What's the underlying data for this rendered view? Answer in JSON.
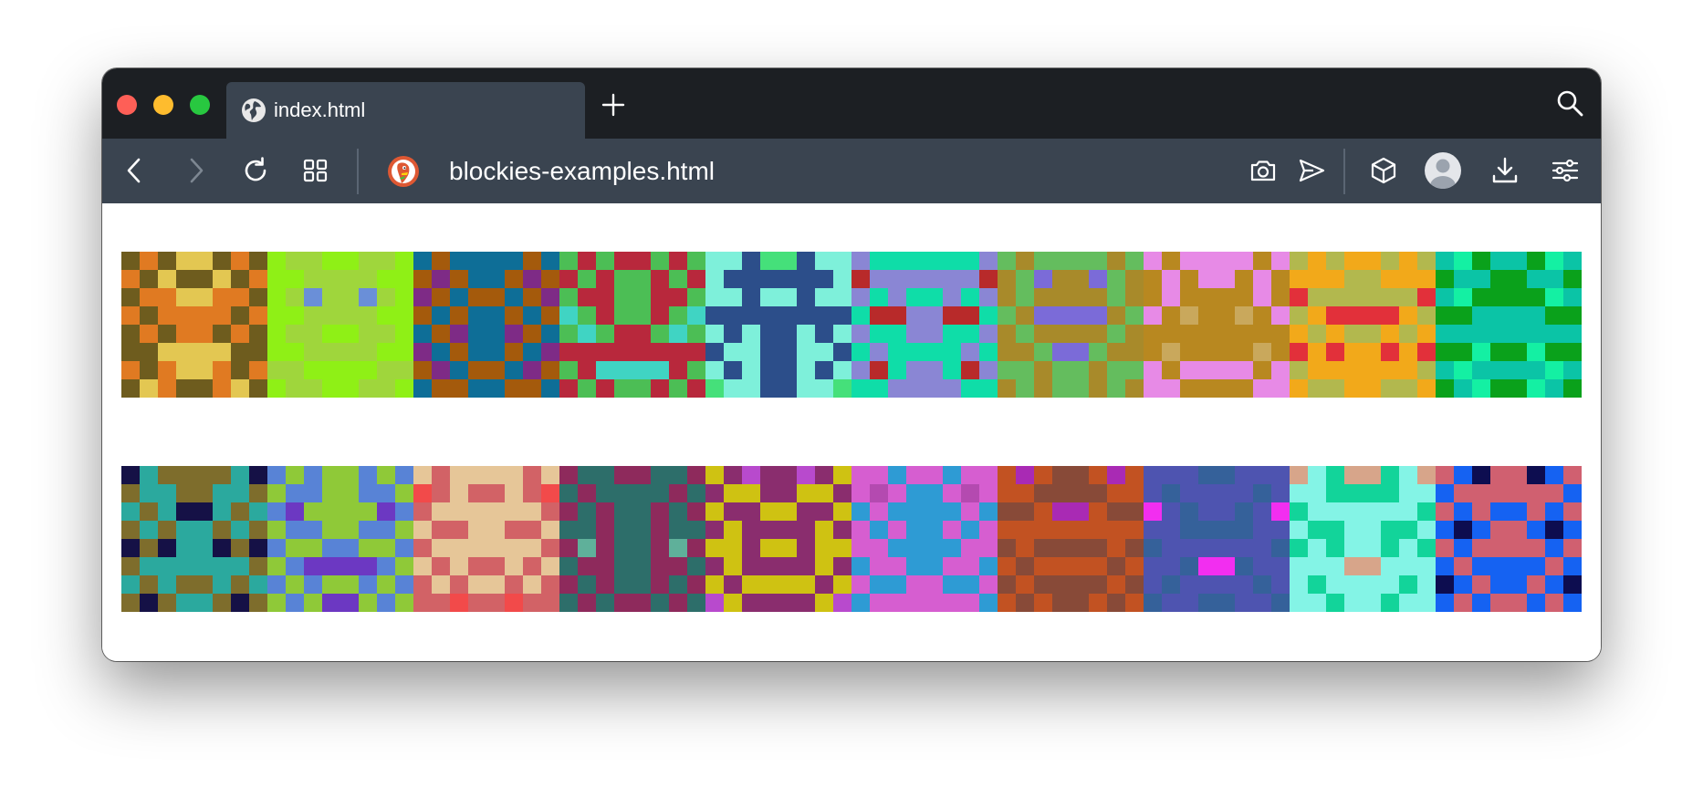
{
  "tab": {
    "title": "index.html",
    "icon": "globe-icon"
  },
  "address_bar": {
    "url": "blockies-examples.html",
    "site_icon": "duckduckgo-icon"
  },
  "toolbar": {
    "back_icon": "back-arrow-icon",
    "forward_icon": "forward-arrow-icon",
    "reload_icon": "reload-icon",
    "tabs_icon": "tab-grid-icon",
    "screenshot_icon": "camera-icon",
    "share_icon": "send-icon",
    "extensions_icon": "cube-icon",
    "profile_icon": "avatar-icon",
    "downloads_icon": "download-icon",
    "settings_icon": "sliders-icon"
  },
  "colors": {
    "titlebar": "#1c1f23",
    "toolbar": "#3a4450",
    "tab_active": "#3a4450",
    "close": "#fe5f57",
    "minimize": "#febc2e",
    "maximize": "#28c840"
  },
  "blockies": [
    {
      "colors": [
        "#6e5c1e",
        "#e07a22",
        "#e3c752"
      ],
      "pattern": [
        0,
        1,
        0,
        2,
        2,
        0,
        1,
        0,
        1,
        0,
        2,
        0,
        0,
        2,
        0,
        1,
        0,
        1,
        1,
        2,
        2,
        1,
        1,
        0,
        1,
        0,
        1,
        1,
        1,
        1,
        0,
        1,
        0,
        1,
        0,
        1,
        1,
        0,
        1,
        0,
        0,
        0,
        2,
        2,
        2,
        2,
        0,
        0,
        1,
        0,
        1,
        2,
        2,
        1,
        0,
        1,
        0,
        2,
        1,
        0,
        0,
        1,
        2,
        0
      ]
    },
    {
      "colors": [
        "#8ff016",
        "#9fd63c",
        "#6a8fd8"
      ],
      "pattern": [
        0,
        1,
        1,
        0,
        0,
        1,
        1,
        0,
        0,
        0,
        1,
        1,
        1,
        1,
        0,
        0,
        0,
        1,
        2,
        1,
        1,
        2,
        1,
        0,
        0,
        0,
        1,
        1,
        1,
        1,
        0,
        0,
        0,
        1,
        1,
        0,
        0,
        1,
        1,
        0,
        0,
        0,
        1,
        1,
        1,
        1,
        0,
        0,
        1,
        1,
        0,
        0,
        0,
        0,
        1,
        1,
        0,
        1,
        1,
        0,
        0,
        1,
        1,
        0
      ]
    },
    {
      "colors": [
        "#a45a0c",
        "#0e6e97",
        "#7e2b86"
      ],
      "pattern": [
        1,
        0,
        1,
        1,
        1,
        1,
        0,
        1,
        0,
        2,
        0,
        1,
        1,
        0,
        2,
        0,
        2,
        0,
        1,
        0,
        0,
        1,
        0,
        2,
        0,
        1,
        0,
        1,
        1,
        0,
        1,
        0,
        1,
        0,
        2,
        1,
        1,
        2,
        0,
        1,
        2,
        1,
        0,
        1,
        1,
        0,
        1,
        2,
        0,
        2,
        1,
        0,
        0,
        1,
        2,
        0,
        1,
        0,
        0,
        1,
        1,
        0,
        0,
        1
      ]
    },
    {
      "colors": [
        "#4cbe55",
        "#b8283c",
        "#40d4c3"
      ],
      "pattern": [
        0,
        1,
        0,
        1,
        1,
        0,
        1,
        0,
        1,
        0,
        1,
        0,
        0,
        1,
        0,
        1,
        0,
        1,
        1,
        0,
        0,
        1,
        1,
        0,
        2,
        0,
        1,
        0,
        0,
        1,
        0,
        2,
        0,
        2,
        0,
        1,
        1,
        0,
        2,
        0,
        1,
        1,
        1,
        1,
        1,
        1,
        1,
        1,
        0,
        1,
        2,
        2,
        2,
        2,
        1,
        0,
        1,
        0,
        1,
        0,
        0,
        1,
        0,
        1
      ]
    },
    {
      "colors": [
        "#7ef0da",
        "#2c4e8a",
        "#45e07a"
      ],
      "pattern": [
        0,
        0,
        1,
        2,
        2,
        1,
        0,
        0,
        0,
        1,
        1,
        1,
        1,
        1,
        1,
        0,
        0,
        0,
        1,
        0,
        0,
        1,
        0,
        0,
        1,
        1,
        1,
        1,
        1,
        1,
        1,
        1,
        0,
        1,
        0,
        1,
        1,
        0,
        1,
        0,
        1,
        0,
        0,
        1,
        1,
        0,
        0,
        1,
        0,
        1,
        0,
        1,
        1,
        0,
        1,
        0,
        2,
        0,
        0,
        1,
        1,
        0,
        0,
        2
      ]
    },
    {
      "colors": [
        "#8a86d4",
        "#0fdda8",
        "#b82a2a"
      ],
      "pattern": [
        0,
        1,
        1,
        1,
        1,
        1,
        1,
        0,
        2,
        0,
        0,
        0,
        0,
        0,
        0,
        2,
        0,
        1,
        0,
        1,
        1,
        0,
        1,
        0,
        1,
        2,
        2,
        0,
        0,
        2,
        2,
        1,
        0,
        1,
        1,
        0,
        0,
        1,
        1,
        0,
        1,
        0,
        1,
        1,
        1,
        1,
        0,
        1,
        0,
        2,
        1,
        0,
        0,
        1,
        2,
        0,
        1,
        1,
        0,
        0,
        0,
        0,
        1,
        1
      ]
    },
    {
      "colors": [
        "#a88a2a",
        "#64bd5e",
        "#7b6bd8"
      ],
      "pattern": [
        1,
        0,
        1,
        1,
        1,
        1,
        0,
        1,
        0,
        1,
        2,
        0,
        0,
        2,
        1,
        0,
        0,
        1,
        0,
        0,
        0,
        0,
        1,
        0,
        1,
        0,
        2,
        2,
        2,
        2,
        0,
        1,
        0,
        1,
        0,
        0,
        0,
        0,
        1,
        0,
        0,
        0,
        1,
        2,
        2,
        1,
        0,
        0,
        1,
        1,
        0,
        1,
        1,
        0,
        1,
        1,
        0,
        1,
        0,
        1,
        1,
        0,
        1,
        0
      ]
    },
    {
      "colors": [
        "#b88820",
        "#e78ae6",
        "#c9a85c"
      ],
      "pattern": [
        1,
        0,
        1,
        1,
        1,
        1,
        0,
        1,
        0,
        1,
        0,
        1,
        1,
        0,
        1,
        0,
        0,
        1,
        0,
        0,
        0,
        0,
        1,
        0,
        1,
        0,
        2,
        0,
        0,
        2,
        0,
        1,
        0,
        0,
        0,
        0,
        0,
        0,
        0,
        0,
        0,
        2,
        0,
        0,
        0,
        0,
        2,
        0,
        1,
        0,
        1,
        1,
        1,
        1,
        0,
        1,
        1,
        1,
        0,
        0,
        0,
        0,
        1,
        1
      ]
    },
    {
      "colors": [
        "#b2b84e",
        "#f2a91a",
        "#e2303a"
      ],
      "pattern": [
        0,
        1,
        0,
        1,
        1,
        0,
        1,
        0,
        1,
        1,
        1,
        0,
        0,
        1,
        1,
        1,
        2,
        0,
        0,
        0,
        0,
        0,
        0,
        2,
        0,
        1,
        2,
        2,
        2,
        2,
        1,
        0,
        1,
        0,
        1,
        0,
        0,
        1,
        0,
        1,
        2,
        1,
        2,
        1,
        1,
        2,
        1,
        2,
        0,
        1,
        1,
        1,
        1,
        1,
        1,
        0,
        1,
        0,
        0,
        1,
        1,
        0,
        0,
        1
      ]
    },
    {
      "colors": [
        "#0bc4a6",
        "#0aa11b",
        "#14f0a3"
      ],
      "pattern": [
        0,
        2,
        1,
        0,
        0,
        1,
        2,
        0,
        1,
        0,
        0,
        1,
        1,
        0,
        0,
        1,
        0,
        2,
        1,
        1,
        1,
        1,
        2,
        0,
        1,
        1,
        0,
        0,
        0,
        0,
        1,
        1,
        0,
        0,
        0,
        0,
        0,
        0,
        0,
        0,
        1,
        1,
        2,
        1,
        1,
        2,
        1,
        1,
        0,
        2,
        0,
        0,
        0,
        0,
        2,
        0,
        1,
        0,
        2,
        1,
        1,
        2,
        0,
        1
      ]
    },
    {
      "colors": [
        "#7e6d2c",
        "#2ba99e",
        "#151146"
      ],
      "pattern": [
        2,
        1,
        0,
        0,
        0,
        0,
        1,
        2,
        0,
        1,
        1,
        0,
        0,
        1,
        1,
        0,
        1,
        0,
        1,
        2,
        2,
        1,
        0,
        1,
        0,
        1,
        0,
        1,
        1,
        0,
        1,
        0,
        2,
        0,
        2,
        1,
        1,
        2,
        0,
        2,
        0,
        1,
        1,
        1,
        1,
        1,
        1,
        0,
        1,
        0,
        1,
        0,
        0,
        1,
        0,
        1,
        0,
        2,
        0,
        1,
        1,
        0,
        2,
        0
      ]
    },
    {
      "colors": [
        "#5883d6",
        "#8fc938",
        "#6c38c2"
      ],
      "pattern": [
        0,
        1,
        0,
        1,
        1,
        0,
        1,
        0,
        1,
        0,
        0,
        1,
        1,
        0,
        0,
        1,
        0,
        2,
        1,
        1,
        1,
        1,
        2,
        0,
        1,
        0,
        0,
        1,
        1,
        0,
        0,
        1,
        0,
        1,
        1,
        0,
        0,
        1,
        1,
        0,
        1,
        0,
        2,
        2,
        2,
        2,
        0,
        1,
        0,
        1,
        0,
        1,
        1,
        0,
        1,
        0,
        1,
        0,
        1,
        2,
        2,
        1,
        0,
        1
      ]
    },
    {
      "colors": [
        "#d26266",
        "#e6c698",
        "#f24a4a"
      ],
      "pattern": [
        1,
        0,
        1,
        1,
        1,
        1,
        0,
        1,
        2,
        0,
        1,
        0,
        0,
        1,
        0,
        2,
        0,
        1,
        1,
        1,
        1,
        1,
        1,
        0,
        1,
        0,
        0,
        1,
        1,
        0,
        0,
        1,
        0,
        1,
        1,
        1,
        1,
        1,
        1,
        0,
        1,
        0,
        1,
        0,
        0,
        1,
        0,
        1,
        0,
        1,
        0,
        1,
        1,
        0,
        1,
        0,
        0,
        0,
        2,
        0,
        0,
        2,
        0,
        0
      ]
    },
    {
      "colors": [
        "#8e2a5c",
        "#2d6e6a",
        "#5fb09a"
      ],
      "pattern": [
        0,
        1,
        1,
        0,
        0,
        1,
        1,
        0,
        1,
        0,
        1,
        1,
        1,
        1,
        0,
        1,
        0,
        1,
        0,
        1,
        1,
        0,
        1,
        0,
        1,
        1,
        0,
        1,
        1,
        0,
        1,
        1,
        0,
        2,
        0,
        1,
        1,
        0,
        2,
        0,
        1,
        0,
        0,
        1,
        1,
        0,
        0,
        1,
        0,
        1,
        0,
        1,
        1,
        0,
        1,
        0,
        1,
        0,
        1,
        0,
        0,
        1,
        0,
        1
      ]
    },
    {
      "colors": [
        "#cfc212",
        "#8a2d6e",
        "#b84acd"
      ],
      "pattern": [
        0,
        1,
        2,
        1,
        1,
        2,
        1,
        0,
        1,
        0,
        0,
        1,
        1,
        0,
        0,
        1,
        0,
        1,
        1,
        0,
        0,
        1,
        1,
        0,
        1,
        0,
        1,
        1,
        1,
        1,
        0,
        1,
        0,
        0,
        1,
        0,
        0,
        1,
        0,
        0,
        1,
        0,
        1,
        1,
        1,
        1,
        0,
        1,
        0,
        1,
        0,
        0,
        0,
        0,
        1,
        0,
        2,
        0,
        1,
        1,
        1,
        1,
        0,
        2
      ]
    },
    {
      "colors": [
        "#d65ed0",
        "#2e9bd4",
        "#b44ab0"
      ],
      "pattern": [
        0,
        0,
        1,
        0,
        0,
        1,
        0,
        0,
        0,
        2,
        0,
        1,
        1,
        0,
        2,
        0,
        1,
        0,
        1,
        1,
        1,
        1,
        0,
        1,
        0,
        1,
        0,
        1,
        1,
        0,
        1,
        0,
        0,
        0,
        1,
        1,
        1,
        1,
        0,
        0,
        1,
        0,
        0,
        1,
        1,
        0,
        0,
        1,
        0,
        1,
        1,
        0,
        0,
        1,
        1,
        0,
        1,
        0,
        0,
        0,
        0,
        0,
        0,
        1
      ]
    },
    {
      "colors": [
        "#c25222",
        "#884a38",
        "#a92ab4"
      ],
      "pattern": [
        0,
        2,
        0,
        1,
        1,
        0,
        2,
        0,
        0,
        0,
        1,
        1,
        1,
        1,
        0,
        0,
        1,
        1,
        0,
        2,
        2,
        0,
        1,
        1,
        0,
        0,
        0,
        0,
        0,
        0,
        0,
        0,
        1,
        0,
        1,
        1,
        1,
        1,
        0,
        1,
        0,
        1,
        0,
        0,
        0,
        0,
        1,
        0,
        1,
        0,
        1,
        1,
        1,
        1,
        0,
        1,
        0,
        1,
        0,
        1,
        1,
        0,
        1,
        0
      ]
    },
    {
      "colors": [
        "#4e54b0",
        "#35619a",
        "#f22ef0"
      ],
      "pattern": [
        0,
        0,
        0,
        1,
        1,
        0,
        0,
        0,
        0,
        1,
        0,
        0,
        0,
        0,
        1,
        0,
        2,
        0,
        1,
        0,
        0,
        1,
        0,
        2,
        0,
        0,
        1,
        1,
        1,
        1,
        0,
        0,
        1,
        0,
        0,
        0,
        0,
        0,
        0,
        1,
        0,
        0,
        1,
        2,
        2,
        1,
        0,
        0,
        0,
        1,
        0,
        0,
        0,
        0,
        1,
        0,
        1,
        0,
        0,
        1,
        1,
        0,
        0,
        1
      ]
    },
    {
      "colors": [
        "#84f4e6",
        "#12d49a",
        "#d7a58a"
      ],
      "pattern": [
        2,
        0,
        1,
        2,
        2,
        1,
        0,
        2,
        0,
        0,
        1,
        1,
        1,
        1,
        0,
        0,
        1,
        0,
        0,
        0,
        0,
        0,
        0,
        1,
        0,
        1,
        1,
        0,
        0,
        1,
        1,
        0,
        1,
        0,
        1,
        0,
        0,
        1,
        0,
        1,
        0,
        0,
        0,
        2,
        2,
        0,
        0,
        0,
        0,
        1,
        0,
        0,
        0,
        0,
        1,
        0,
        0,
        0,
        1,
        0,
        0,
        1,
        0,
        0
      ]
    },
    {
      "colors": [
        "#1562f2",
        "#d06070",
        "#0d0d50"
      ],
      "pattern": [
        1,
        0,
        2,
        1,
        1,
        2,
        0,
        1,
        0,
        1,
        1,
        1,
        1,
        1,
        1,
        0,
        1,
        0,
        1,
        0,
        0,
        1,
        0,
        1,
        0,
        2,
        0,
        1,
        1,
        0,
        2,
        0,
        1,
        0,
        1,
        1,
        1,
        1,
        0,
        1,
        0,
        1,
        0,
        0,
        0,
        0,
        1,
        0,
        2,
        0,
        1,
        0,
        0,
        1,
        0,
        2,
        0,
        1,
        0,
        1,
        1,
        0,
        1,
        0
      ]
    }
  ]
}
